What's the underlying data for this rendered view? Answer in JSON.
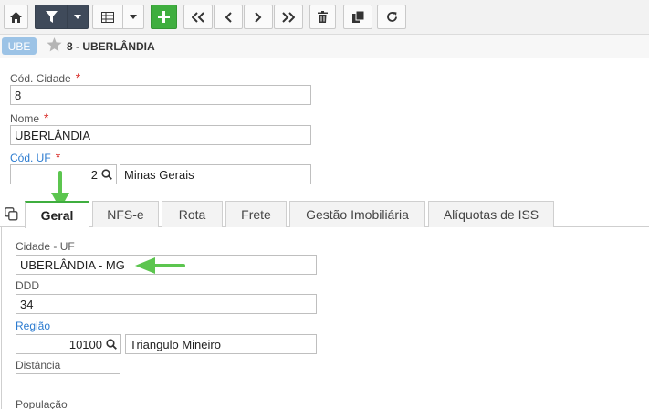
{
  "toolbar": {
    "buttons": [
      "home-icon",
      "filter-icon",
      "grid-icon",
      "add-icon",
      "first-icon",
      "prev-icon",
      "next-icon",
      "last-icon",
      "delete-icon",
      "copy-record-icon",
      "refresh-icon"
    ]
  },
  "titlebar": {
    "badge": "UBE",
    "title": "8 - UBERLÂNDIA"
  },
  "form": {
    "cod_cidade_label": "Cód. Cidade",
    "cod_cidade_value": "8",
    "nome_label": "Nome",
    "nome_value": "UBERLÂNDIA",
    "cod_uf_label": "Cód. UF",
    "cod_uf_value": "2",
    "uf_name": "Minas Gerais",
    "required_mark": "*"
  },
  "tabs": [
    {
      "label": "Geral",
      "active": true
    },
    {
      "label": "NFS-e",
      "active": false
    },
    {
      "label": "Rota",
      "active": false
    },
    {
      "label": "Frete",
      "active": false
    },
    {
      "label": "Gestão Imobiliária",
      "active": false
    },
    {
      "label": "Alíquotas de ISS",
      "active": false
    }
  ],
  "geral": {
    "cidade_uf_label": "Cidade - UF",
    "cidade_uf_value": "UBERLÂNDIA - MG",
    "ddd_label": "DDD",
    "ddd_value": "34",
    "regiao_label": "Região",
    "regiao_code": "10100",
    "regiao_name": "Triangulo Mineiro",
    "distancia_label": "Distância",
    "distancia_value": "",
    "populacao_label": "População"
  },
  "colors": {
    "accent_green": "#3fae3f",
    "dark_button": "#3f4a5a",
    "link_blue": "#2b7bd0",
    "required_red": "#d9302c",
    "badge_blue": "#9cc3e6"
  }
}
